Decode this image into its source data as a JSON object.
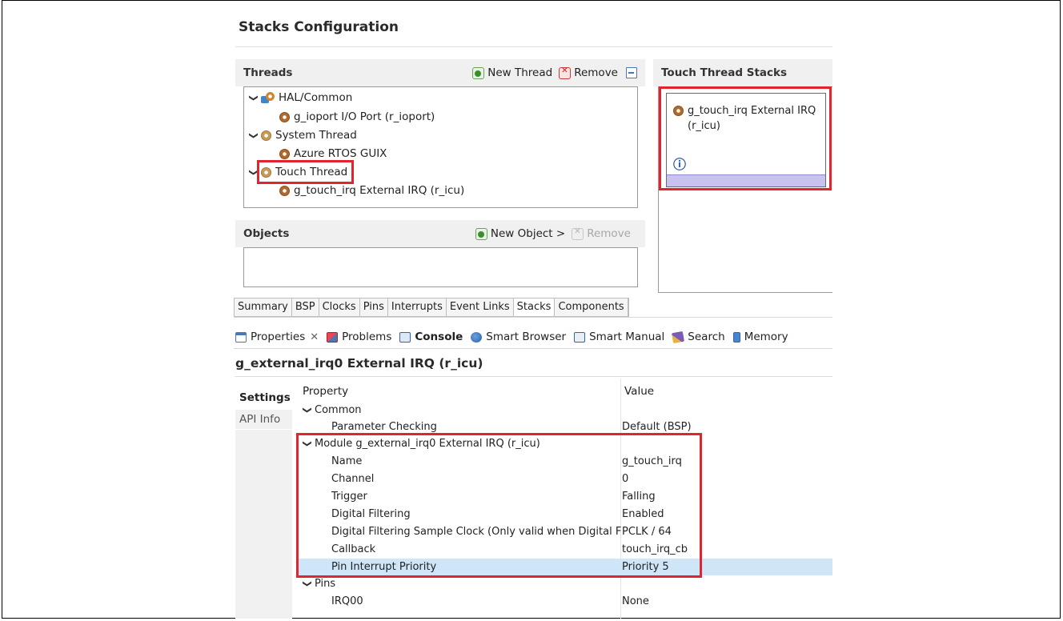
{
  "page_title": "Stacks Configuration",
  "threads": {
    "heading": "Threads",
    "new_label": "New Thread",
    "remove_label": "Remove",
    "tree": [
      {
        "label": "HAL/Common",
        "level": 0,
        "expanded": true,
        "icon": "hal-common-icon"
      },
      {
        "label": "g_ioport I/O Port (r_ioport)",
        "level": 1,
        "icon": "module-icon"
      },
      {
        "label": "System Thread",
        "level": 0,
        "expanded": true,
        "icon": "thread-icon"
      },
      {
        "label": "Azure RTOS GUIX",
        "level": 1,
        "icon": "module-icon"
      },
      {
        "label": "Touch Thread",
        "level": 0,
        "expanded": true,
        "icon": "thread-icon",
        "highlighted": true
      },
      {
        "label": "g_touch_irq External IRQ (r_icu)",
        "level": 1,
        "icon": "module-icon"
      }
    ]
  },
  "objects": {
    "heading": "Objects",
    "new_label": "New Object >",
    "remove_label": "Remove"
  },
  "stacks_panel": {
    "heading": "Touch Thread Stacks",
    "block_label_line1": "g_touch_irq External IRQ",
    "block_label_line2": "(r_icu)",
    "info_icon": "ⓘ"
  },
  "editor_tabs": [
    "Summary",
    "BSP",
    "Clocks",
    "Pins",
    "Interrupts",
    "Event Links",
    "Stacks",
    "Components"
  ],
  "active_editor_tab": "Stacks",
  "views": [
    {
      "label": "Properties",
      "icon": "properties-icon",
      "closable": true
    },
    {
      "label": "Problems",
      "icon": "problems-icon"
    },
    {
      "label": "Console",
      "icon": "console-icon",
      "bold": true
    },
    {
      "label": "Smart Browser",
      "icon": "smart-browser-icon"
    },
    {
      "label": "Smart Manual",
      "icon": "smart-manual-icon"
    },
    {
      "label": "Search",
      "icon": "search-icon"
    },
    {
      "label": "Memory",
      "icon": "memory-icon"
    }
  ],
  "properties_title": "g_external_irq0 External IRQ (r_icu)",
  "side_tabs": [
    "Settings",
    "API Info"
  ],
  "grid": {
    "col_property": "Property",
    "col_value": "Value",
    "rows": [
      {
        "property": "Common",
        "value": "",
        "level": 0,
        "group": true
      },
      {
        "property": "Parameter Checking",
        "value": "Default (BSP)",
        "level": 1
      },
      {
        "property": "Module g_external_irq0 External IRQ (r_icu)",
        "value": "",
        "level": 0,
        "group": true
      },
      {
        "property": "Name",
        "value": "g_touch_irq",
        "level": 1
      },
      {
        "property": "Channel",
        "value": "0",
        "level": 1
      },
      {
        "property": "Trigger",
        "value": "Falling",
        "level": 1
      },
      {
        "property": "Digital Filtering",
        "value": "Enabled",
        "level": 1
      },
      {
        "property": "Digital Filtering Sample Clock (Only valid when Digital Filte",
        "value": "PCLK / 64",
        "level": 1
      },
      {
        "property": "Callback",
        "value": "touch_irq_cb",
        "level": 1
      },
      {
        "property": "Pin Interrupt Priority",
        "value": "Priority 5",
        "level": 1,
        "selected": true
      },
      {
        "property": "Pins",
        "value": "",
        "level": 0,
        "group": true
      },
      {
        "property": "IRQ00",
        "value": "None",
        "level": 1
      }
    ]
  },
  "colors": {
    "highlight_red": "#e0252e",
    "selected_row": "#cfe6f8",
    "stack_block_bar": "#c8c3ee"
  }
}
